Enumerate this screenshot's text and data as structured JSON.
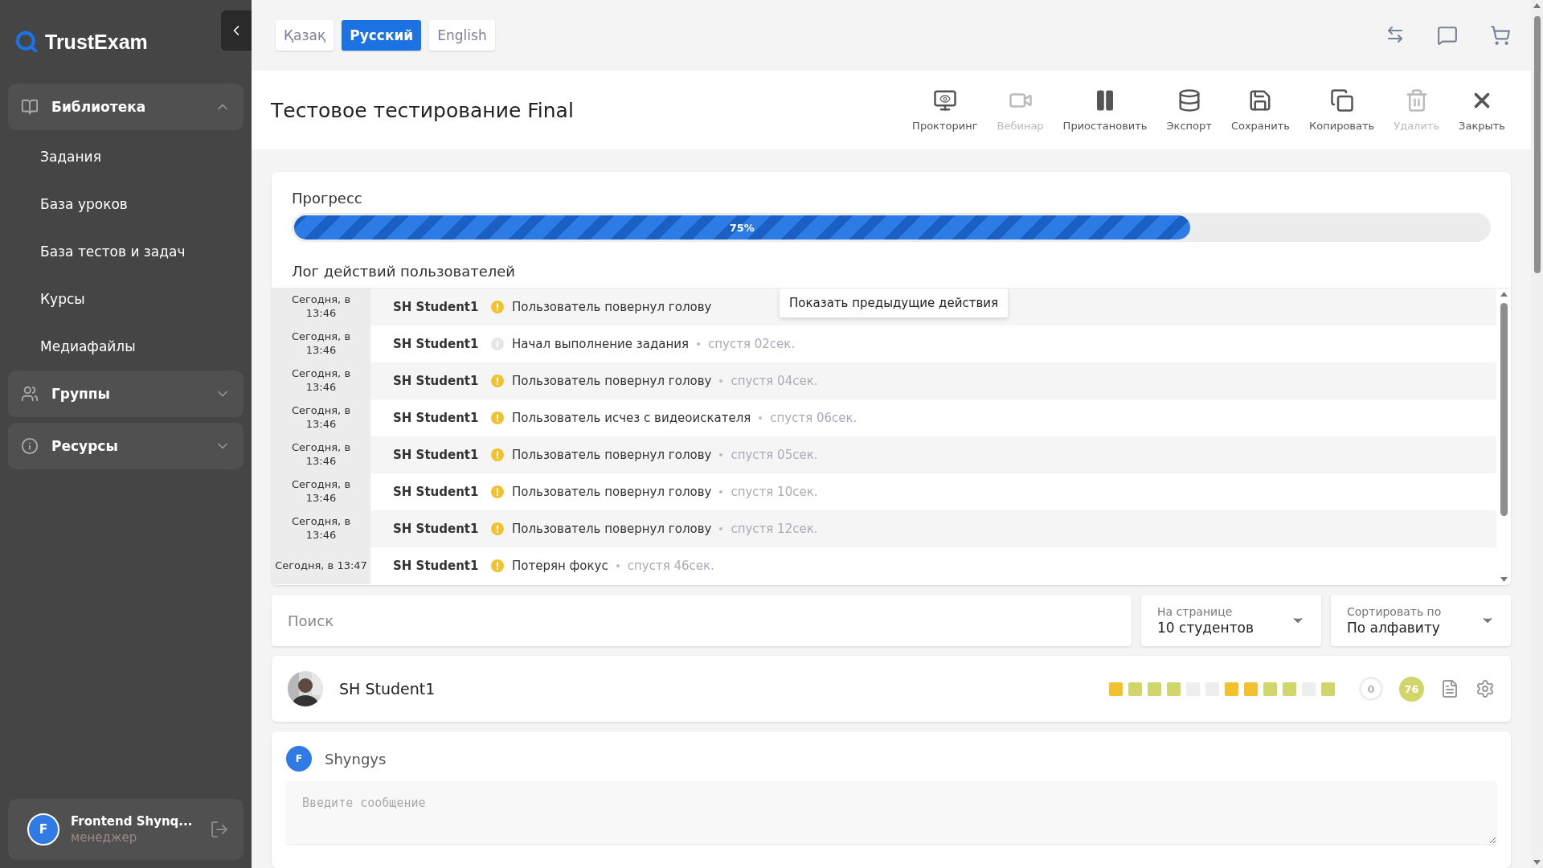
{
  "sidebar": {
    "logo": "TrustExam",
    "sections": [
      {
        "label": "Библиотека",
        "expanded": true,
        "children": [
          {
            "label": "Задания"
          },
          {
            "label": "База уроков"
          },
          {
            "label": "База тестов и задач"
          },
          {
            "label": "Курсы"
          },
          {
            "label": "Медиафайлы"
          }
        ]
      },
      {
        "label": "Группы",
        "expanded": false
      },
      {
        "label": "Ресурсы",
        "expanded": false
      }
    ],
    "user": {
      "initial": "F",
      "name": "Frontend Shynq...",
      "role": "менеджер"
    }
  },
  "languages": [
    {
      "label": "Қазақ",
      "selected": false
    },
    {
      "label": "Русский",
      "selected": true
    },
    {
      "label": "English",
      "selected": false
    }
  ],
  "title": "Тестовое тестирование Final",
  "toolbar": [
    {
      "label": "Прокторинг",
      "disabled": false
    },
    {
      "label": "Вебинар",
      "disabled": true
    },
    {
      "label": "Приостановить",
      "disabled": false
    },
    {
      "label": "Экспорт",
      "disabled": false
    },
    {
      "label": "Сохранить",
      "disabled": false
    },
    {
      "label": "Копировать",
      "disabled": false
    },
    {
      "label": "Удалить",
      "disabled": true
    },
    {
      "label": "Закрыть",
      "disabled": false
    }
  ],
  "progress": {
    "heading": "Прогресс",
    "level": 0.75,
    "reading": "75%"
  },
  "log": {
    "heading": "Лог действий пользователей",
    "tooltip": "Показать предыдущие действия",
    "rows": [
      {
        "date": "Сегодня, в 13:46",
        "user": "SH Student1",
        "kind": "warning",
        "action": "Пользователь повернул голову"
      },
      {
        "date": "Сегодня, в 13:46",
        "user": "SH Student1",
        "kind": "info",
        "action": "Начал выполнение задания",
        "elapsed": "спустя 02сек."
      },
      {
        "date": "Сегодня, в 13:46",
        "user": "SH Student1",
        "kind": "warning",
        "action": "Пользователь повернул голову",
        "elapsed": "спустя 04сек."
      },
      {
        "date": "Сегодня, в 13:46",
        "user": "SH Student1",
        "kind": "warning",
        "action": "Пользователь исчез с видеоискателя",
        "elapsed": "спустя 06сек."
      },
      {
        "date": "Сегодня, в 13:46",
        "user": "SH Student1",
        "kind": "warning",
        "action": "Пользователь повернул голову",
        "elapsed": "спустя 05сек."
      },
      {
        "date": "Сегодня, в 13:46",
        "user": "SH Student1",
        "kind": "warning",
        "action": "Пользователь повернул голову",
        "elapsed": "спустя 10сек."
      },
      {
        "date": "Сегодня, в 13:46",
        "user": "SH Student1",
        "kind": "warning",
        "action": "Пользователь повернул голову",
        "elapsed": "спустя 12сек."
      },
      {
        "date": "Сегодня, в 13:47",
        "user": "SH Student1",
        "kind": "warning",
        "action": "Потерян фокус",
        "elapsed": "спустя 46сек."
      }
    ]
  },
  "search": {
    "placeholder": "Поиск"
  },
  "per_page": {
    "label": "На странице",
    "value": "10 студентов"
  },
  "sort": {
    "label": "Сортировать по",
    "value": "По алфавиту"
  },
  "student": {
    "name": "SH Student1",
    "zero": "0",
    "score": "76",
    "answers": [
      {
        "color": "#f2c12e"
      },
      {
        "color": "#d1d66b"
      },
      {
        "color": "#d1d66b"
      },
      {
        "color": "#d1d66b"
      },
      {
        "color": "#eeeeee"
      },
      {
        "color": "#eeeeee"
      },
      {
        "color": "#f2c12e"
      },
      {
        "color": "#f2c12e"
      },
      {
        "color": "#d1d66b"
      },
      {
        "color": "#d1d66b"
      },
      {
        "color": "#eeeeee"
      },
      {
        "color": "#d1d66b"
      }
    ]
  },
  "chat": {
    "initial": "F",
    "name": "Shyngys",
    "placeholder": "Введите сообщение"
  }
}
